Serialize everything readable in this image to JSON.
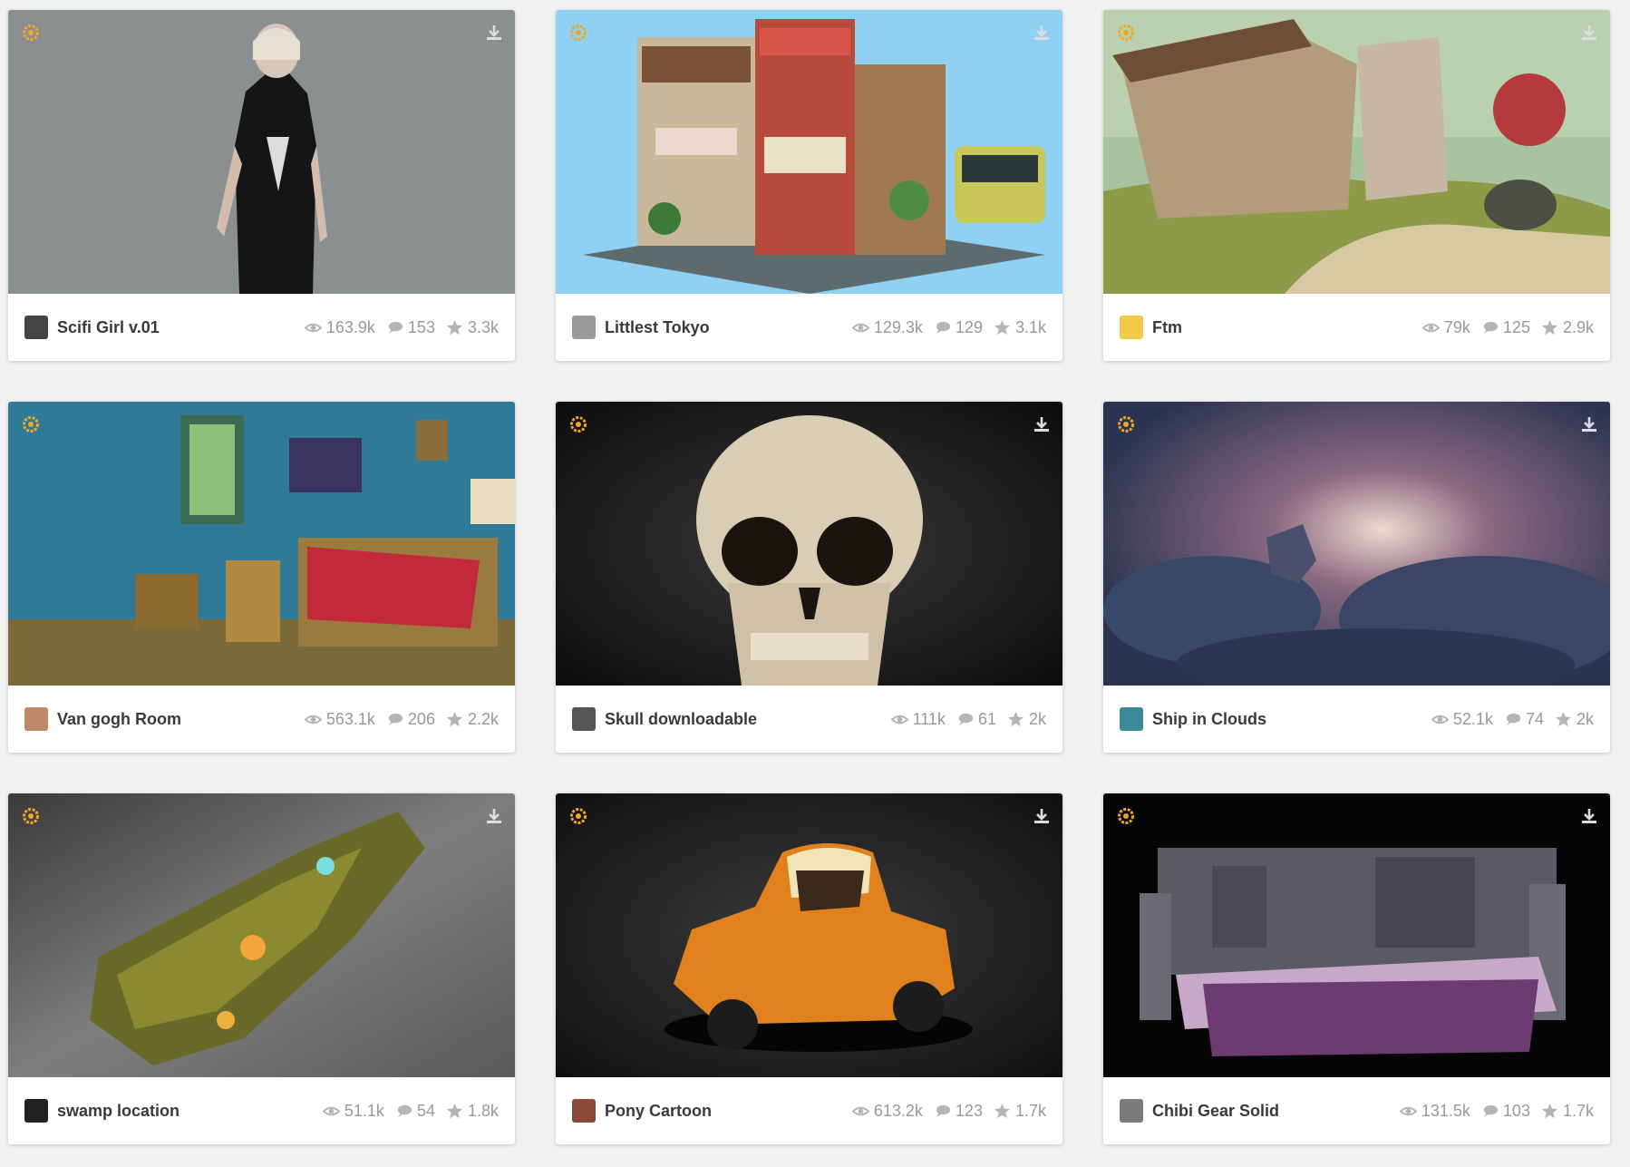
{
  "models": [
    {
      "title": "Scifi Girl v.01",
      "views": "163.9k",
      "comments": "153",
      "likes": "3.3k"
    },
    {
      "title": "Littlest Tokyo",
      "views": "129.3k",
      "comments": "129",
      "likes": "3.1k"
    },
    {
      "title": "Ftm",
      "views": "79k",
      "comments": "125",
      "likes": "2.9k"
    },
    {
      "title": "Van gogh Room",
      "views": "563.1k",
      "comments": "206",
      "likes": "2.2k"
    },
    {
      "title": "Skull downloadable",
      "views": "111k",
      "comments": "61",
      "likes": "2k"
    },
    {
      "title": "Ship in Clouds",
      "views": "52.1k",
      "comments": "74",
      "likes": "2k"
    },
    {
      "title": "swamp location",
      "views": "51.1k",
      "comments": "54",
      "likes": "1.8k"
    },
    {
      "title": "Pony Cartoon",
      "views": "613.2k",
      "comments": "123",
      "likes": "1.7k"
    },
    {
      "title": "Chibi Gear Solid",
      "views": "131.5k",
      "comments": "103",
      "likes": "1.7k"
    }
  ],
  "icons": {
    "badge": "staff-pick-icon",
    "download": "download-icon",
    "views": "eye-icon",
    "comments": "comment-icon",
    "likes": "star-icon"
  },
  "colors": {
    "badge": "#f5a623",
    "stat_text": "#999999",
    "title_text": "#3a3a3a",
    "background": "#f1f1f1"
  }
}
